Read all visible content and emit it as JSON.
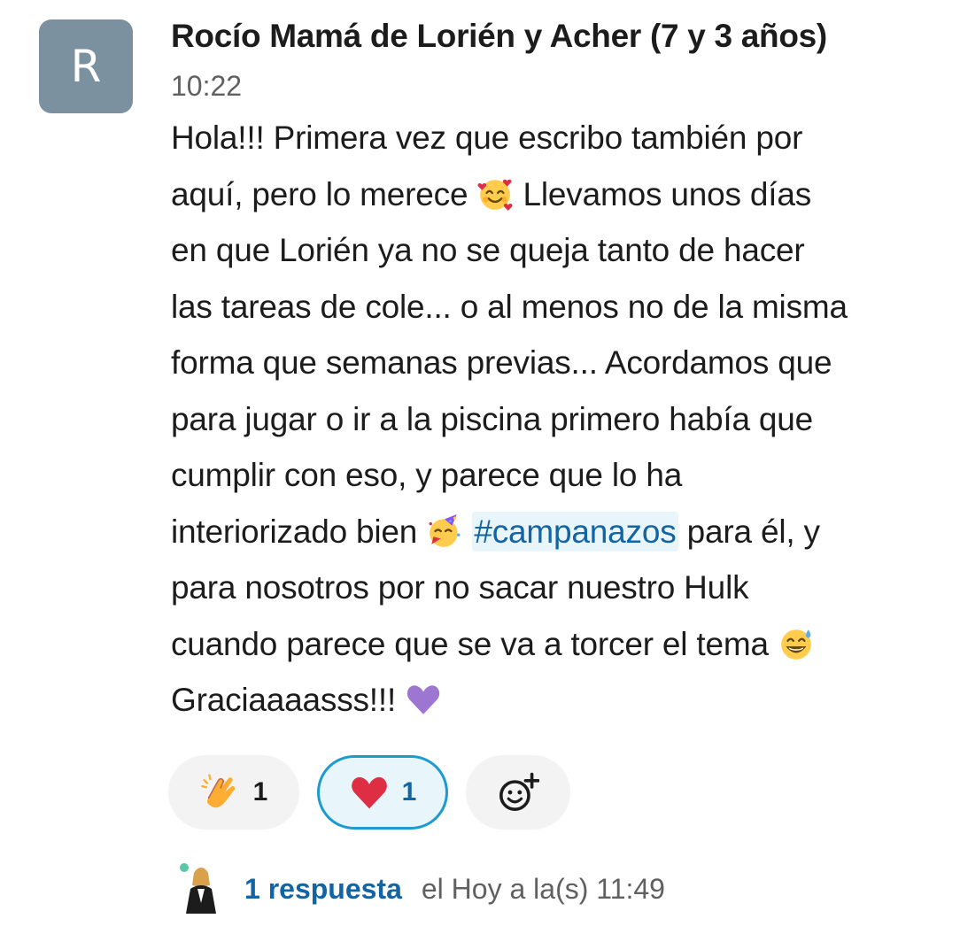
{
  "message": {
    "avatar_letter": "R",
    "author": "Rocío Mamá de Lorién y Acher (7 y 3 años)",
    "time": "10:22",
    "lines": [
      [
        "Hola!!! Primera vez que escribo también por"
      ],
      [
        "aquí, pero lo merece ",
        " Llevamos unos días"
      ],
      [
        "en que Lorién ya no se queja tanto de hacer"
      ],
      [
        "las tareas de cole... o al menos no de la misma"
      ],
      [
        "forma que semanas previas... Acordamos que"
      ],
      [
        "para jugar o ir a la piscina primero había que"
      ],
      [
        "cumplir con eso, y parece que lo ha"
      ],
      [
        "interiorizado bien ",
        "#campanazos",
        " para él, y"
      ],
      [
        "para nosotros por no sacar nuestro Hulk"
      ],
      [
        "cuando parece que se va a torcer el tema "
      ],
      [
        "Graciaaaasss!!! "
      ]
    ],
    "emojis": {
      "smiling_hearts": "smiling-face-with-hearts-icon",
      "partying": "partying-face-icon",
      "sweat_smile": "grinning-sweat-icon",
      "purple_heart": "purple-heart-icon"
    }
  },
  "reactions": [
    {
      "icon": "clapping-hands-icon",
      "count": "1",
      "selected": false
    },
    {
      "icon": "red-heart-icon",
      "count": "1",
      "selected": true
    },
    {
      "icon": "add-reaction-icon"
    }
  ],
  "thread": {
    "replies": "1 respuesta",
    "last_reply": "el Hoy a la(s) 11:49"
  },
  "colors": {
    "link": "#1264a3",
    "avatar_bg": "#7c919f",
    "selected_border": "#1d9bd1",
    "selected_bg": "#e8f5fa"
  }
}
